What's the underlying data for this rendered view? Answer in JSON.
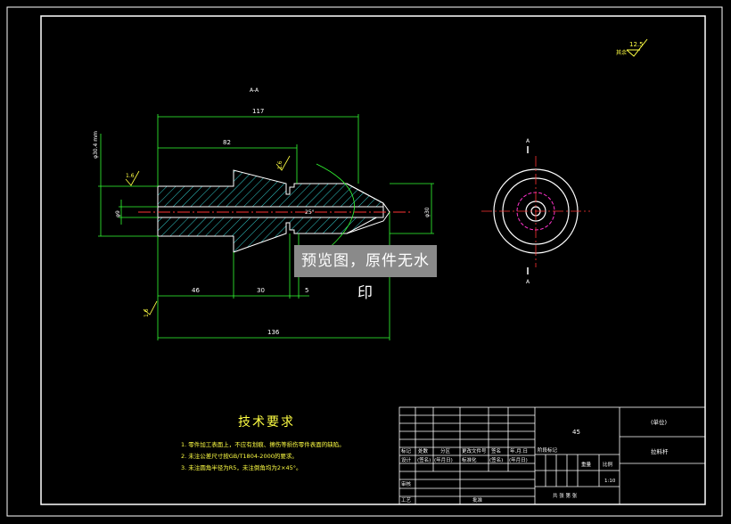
{
  "section_label": "A-A",
  "surface_finish": {
    "rest_label": "其余",
    "rest_value": "12.5",
    "values": [
      "1.6",
      "1.6",
      "1.6"
    ]
  },
  "dimensions": {
    "overall_top": "117",
    "d82": "82",
    "dia_tol": "φ30.4 mm",
    "dia_bore": "φ9",
    "dia_tip": "φ30",
    "angle": "25°",
    "seg_46": "46",
    "seg_30": "30",
    "seg_5": "5",
    "overall_bottom": "136"
  },
  "end_view": {
    "section_top": "A",
    "section_bottom": "A"
  },
  "watermark": "预览图，原件无水印",
  "tech_req": {
    "title": "技术要求",
    "items": [
      "1. 零件加工表面上，不应有划痕、擦伤等损伤零件表面的缺陷。",
      "2. 未注公差尺寸按GB/T1804-2000的要求。",
      "3. 未注圆角半径为R5，未注倒角均为2×45°。"
    ]
  },
  "title_block": {
    "material": "45",
    "unit": "(单位)",
    "drawing_name": "拉料杆",
    "scale": "1:10",
    "header_row1": [
      "标记",
      "处数",
      "分区",
      "更改文件号",
      "签名",
      "年.月.日"
    ],
    "header_row2": [
      "设计",
      "(签名)",
      "(年月日)",
      "标准化",
      "(签名)",
      "(年月日)"
    ],
    "stage_label": "阶段标记",
    "weight_label": "重量",
    "ratio_label": "比例",
    "review_label": "审核",
    "process_label": "工艺",
    "approve_label": "批准",
    "sheets_label": "共 张 第 张"
  }
}
